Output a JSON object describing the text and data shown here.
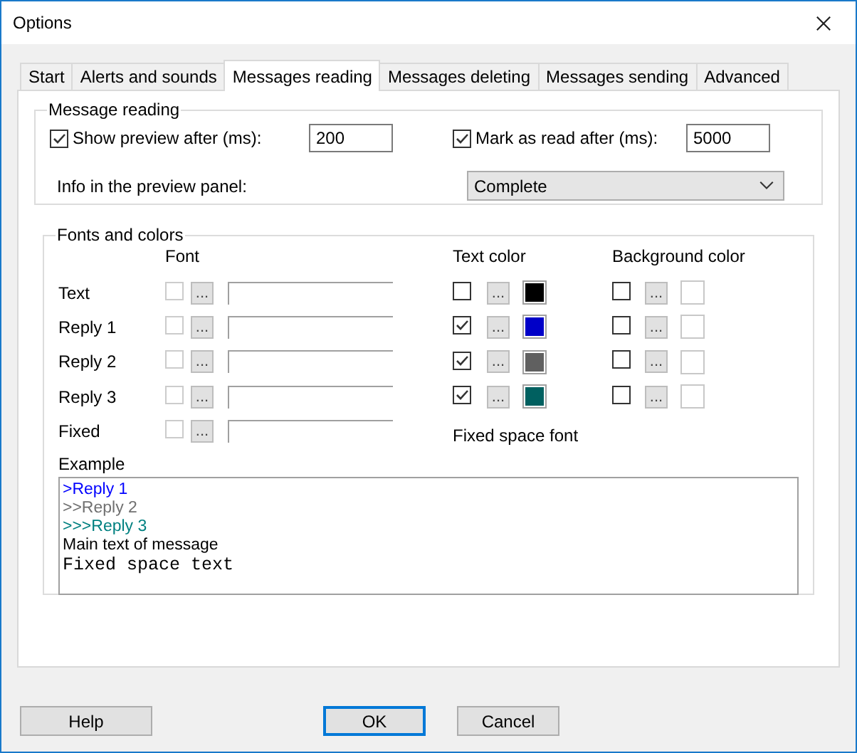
{
  "window": {
    "title": "Options"
  },
  "tabs": [
    {
      "label": "Start",
      "selected": false
    },
    {
      "label": "Alerts and sounds",
      "selected": false
    },
    {
      "label": "Messages reading",
      "selected": true
    },
    {
      "label": "Messages deleting",
      "selected": false
    },
    {
      "label": "Messages sending",
      "selected": false
    },
    {
      "label": "Advanced",
      "selected": false
    }
  ],
  "message_reading": {
    "title": "Message reading",
    "show_preview": {
      "label": "Show preview after (ms):",
      "checked": true,
      "value": "200"
    },
    "mark_as_read": {
      "label": "Mark as read after (ms):",
      "checked": true,
      "value": "5000"
    },
    "preview_info": {
      "label": "Info in the preview panel:",
      "value": "Complete"
    }
  },
  "fonts_and_colors": {
    "title": "Fonts and colors",
    "headers": {
      "font": "Font",
      "text_color": "Text color",
      "background_color": "Background color"
    },
    "rows": [
      {
        "label": "Text",
        "font": {
          "checked": false,
          "disabled": true,
          "button": "..."
        },
        "text_color": {
          "checked": false,
          "button": "...",
          "color": "#000000"
        },
        "background": {
          "checked": false,
          "button": "...",
          "color": "#ffffff"
        }
      },
      {
        "label": "Reply 1",
        "font": {
          "checked": false,
          "disabled": true,
          "button": "..."
        },
        "text_color": {
          "checked": true,
          "button": "...",
          "color": "#0000c8"
        },
        "background": {
          "checked": false,
          "button": "...",
          "color": "#ffffff"
        }
      },
      {
        "label": "Reply 2",
        "font": {
          "checked": false,
          "disabled": true,
          "button": "..."
        },
        "text_color": {
          "checked": true,
          "button": "...",
          "color": "#606060"
        },
        "background": {
          "checked": false,
          "button": "...",
          "color": "#ffffff"
        }
      },
      {
        "label": "Reply 3",
        "font": {
          "checked": false,
          "disabled": true,
          "button": "..."
        },
        "text_color": {
          "checked": true,
          "button": "...",
          "color": "#006060"
        },
        "background": {
          "checked": false,
          "button": "...",
          "color": "#ffffff"
        }
      },
      {
        "label": "Fixed",
        "font": {
          "checked": false,
          "disabled": true,
          "button": "..."
        },
        "note": "Fixed space font"
      }
    ],
    "example": {
      "label": "Example",
      "lines": [
        {
          "kind": "plain",
          "text": ">Reply 1",
          "color": "#0000ff"
        },
        {
          "kind": "plain",
          "text": ">>Reply 2",
          "color": "#707070"
        },
        {
          "kind": "plain",
          "text": ">>>Reply 3",
          "color": "#008080"
        },
        {
          "kind": "plain",
          "text": "Main text of message",
          "color": "#000000"
        },
        {
          "kind": "mono",
          "text": "Fixed space text",
          "color": "#000000"
        }
      ]
    }
  },
  "buttons": [
    {
      "label": "Help",
      "default": false
    },
    {
      "label": "OK",
      "default": true
    },
    {
      "label": "Cancel",
      "default": false
    }
  ]
}
